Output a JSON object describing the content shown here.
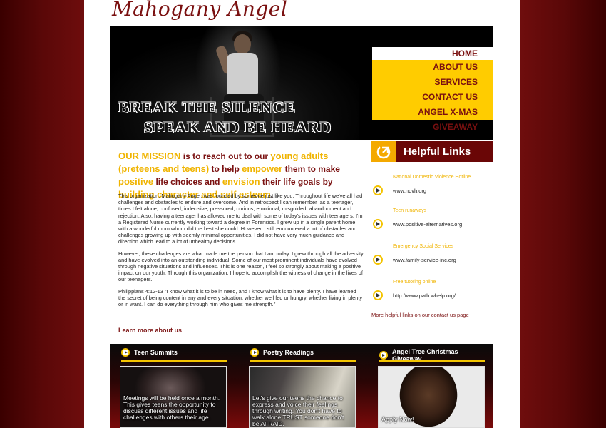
{
  "site": {
    "logo": "Mahogany Angel"
  },
  "hero": {
    "line1": "BREAK THE SILENCE",
    "line2": "SPEAK AND BE HEARD"
  },
  "nav": {
    "items": [
      {
        "label": "HOME"
      },
      {
        "label": "ABOUT US"
      },
      {
        "label": "SERVICES"
      },
      {
        "label": "CONTACT US"
      },
      {
        "label": "ANGEL X-MAS GIVEAWAY"
      }
    ]
  },
  "mission": {
    "p1": "OUR MISSION",
    "p2": " is to reach out to our ",
    "p3": "young adults (preteens and teens)",
    "p4": " to help ",
    "p5": "empower",
    "p6": " them to make ",
    "p7": "positive",
    "p8": " life choices and ",
    "p9": "envision",
    "p10": " their life goals by ",
    "p11": "building character and self esteem",
    "p12": "."
  },
  "body": {
    "para1": "This organization, Mahogany Angel, was founded by someone just like you. Throughout life we've all had challenges and obstacles to endure and overcome. And in retrospect I can remember ,as a teenager, times I felt alone, confused, indecisive, pressured, curious, emotional, misguided, abandonment and rejection. Also, having a teenager has allowed me to deal with some of today's issues with teenagers. I'm a Registered Nurse currently working toward a degree in Forensics. I grew up in a single parent home; with a wonderful mom whom did the best she could. However, I still encountered a lot of obstacles and challenges growing up with seemly minimal opportunities. I did not have very much guidance and direction which lead to a lot of unhealthy decisions.",
    "para2": "However, these challenges are what made me the person that I am today. I grew through all the adversity and have evolved into an outstanding individual. Some of our most prominent individuals have evolved through negative situations and influences. This is one reason, I feel so strongly about making a positive impact on our youth. Through this organization, I hope to accomplish the witness of change in the lives of our teenagers.",
    "para3": "Philippians 4:12-13 \"I know what it is to be in need, and I know what it is to have plenty. I have learned the secret of being content in any and every situation, whether well fed or hungry, whether living in plenty or in want. I can do everything through him who gives me strength.\"",
    "learn_more": "Learn more about us"
  },
  "helpful": {
    "title": "Helpful Links",
    "links": [
      {
        "category": "National Domestic Violence Hotline",
        "url": "www.ndvh.org"
      },
      {
        "category": "Teen runaways",
        "url": "www.positive-alternatives.org"
      },
      {
        "category": "Emergency Social Services",
        "url": "www.family-service-inc.org"
      },
      {
        "category": "Free tutoring online",
        "url": "http://www.path whelp.org/"
      }
    ],
    "more": "More helpful links on our contact us page"
  },
  "features": [
    {
      "title": "Teen Summits",
      "caption": "Meetings will be held once a month. This gives teens the opportunity to discuss different issues and life challenges with others their age."
    },
    {
      "title": "Poetry Readings",
      "caption": "Let's give our teens the chance to express and voice their feelings through writing.  You don't have to walk alone TRUST someone don't be AFRAID."
    },
    {
      "title": "Angel Tree Christmas Giveaway",
      "caption": "Apply Now!"
    }
  ],
  "colors": {
    "brand": "#7a1010",
    "accent": "#ffcc00",
    "dark": "#6a0606"
  }
}
